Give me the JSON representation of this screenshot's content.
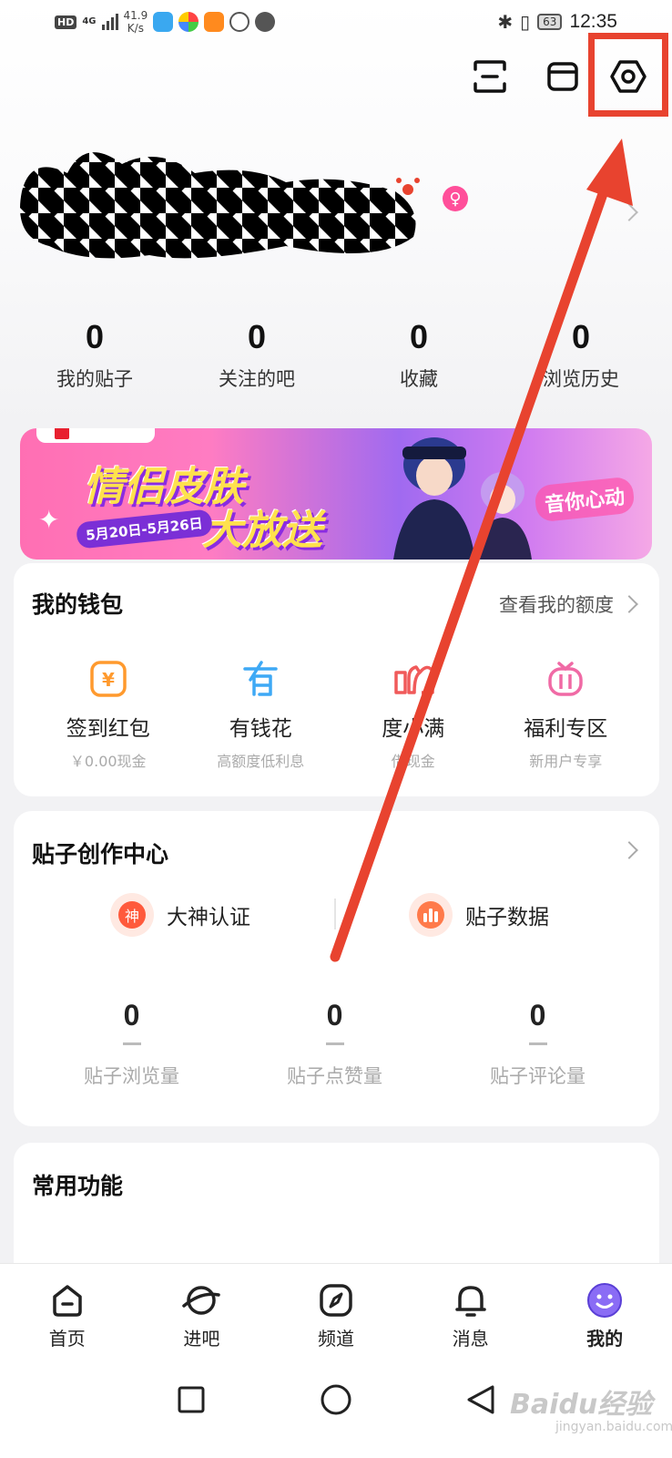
{
  "status_bar": {
    "hd": "HD",
    "network": "4G",
    "speed_value": "41.9",
    "speed_unit": "K/s",
    "battery": "63",
    "time": "12:35"
  },
  "header": {
    "icons": [
      "scan-icon",
      "box-icon",
      "settings-hexagon-icon"
    ]
  },
  "profile": {
    "gender_symbol": "♀"
  },
  "stats": [
    {
      "value": "0",
      "label": "我的贴子"
    },
    {
      "value": "0",
      "label": "关注的吧"
    },
    {
      "value": "0",
      "label": "收藏"
    },
    {
      "value": "0",
      "label": "浏览历史"
    }
  ],
  "banner": {
    "title1": "情侣皮肤",
    "title2": "大放送",
    "date": "5月20日-5月26日",
    "slogan": "音你心动"
  },
  "wallet": {
    "title": "我的钱包",
    "link": "查看我的额度",
    "items": [
      {
        "label": "签到红包",
        "sub": "￥0.00现金",
        "icon": "yen-icon",
        "color": "#ff9a2e"
      },
      {
        "label": "有钱花",
        "sub": "高额度低利息",
        "icon": "youqianhua-icon",
        "color": "#3ea9f5"
      },
      {
        "label": "度小满",
        "sub": "借现金",
        "icon": "duxiaoman-icon",
        "color": "#f05a5a"
      },
      {
        "label": "福利专区",
        "sub": "新用户专享",
        "icon": "gift-icon",
        "color": "#f06aa5"
      }
    ]
  },
  "creator": {
    "title": "贴子创作中心",
    "auth_label": "大神认证",
    "auth_glyph": "神",
    "data_label": "贴子数据",
    "stats": [
      {
        "value": "0",
        "label": "贴子浏览量"
      },
      {
        "value": "0",
        "label": "贴子点赞量"
      },
      {
        "value": "0",
        "label": "贴子评论量"
      }
    ]
  },
  "common": {
    "title": "常用功能"
  },
  "tabs": [
    {
      "label": "首页",
      "icon": "home-icon"
    },
    {
      "label": "进吧",
      "icon": "planet-icon"
    },
    {
      "label": "频道",
      "icon": "compass-icon"
    },
    {
      "label": "消息",
      "icon": "bell-icon"
    },
    {
      "label": "我的",
      "icon": "smiley-icon",
      "active": true
    }
  ],
  "watermark": {
    "main": "Baidu经验",
    "sub": "jingyan.baidu.com"
  },
  "colors": {
    "annotation_red": "#e8432f",
    "accent_purple": "#7b5cf0"
  }
}
